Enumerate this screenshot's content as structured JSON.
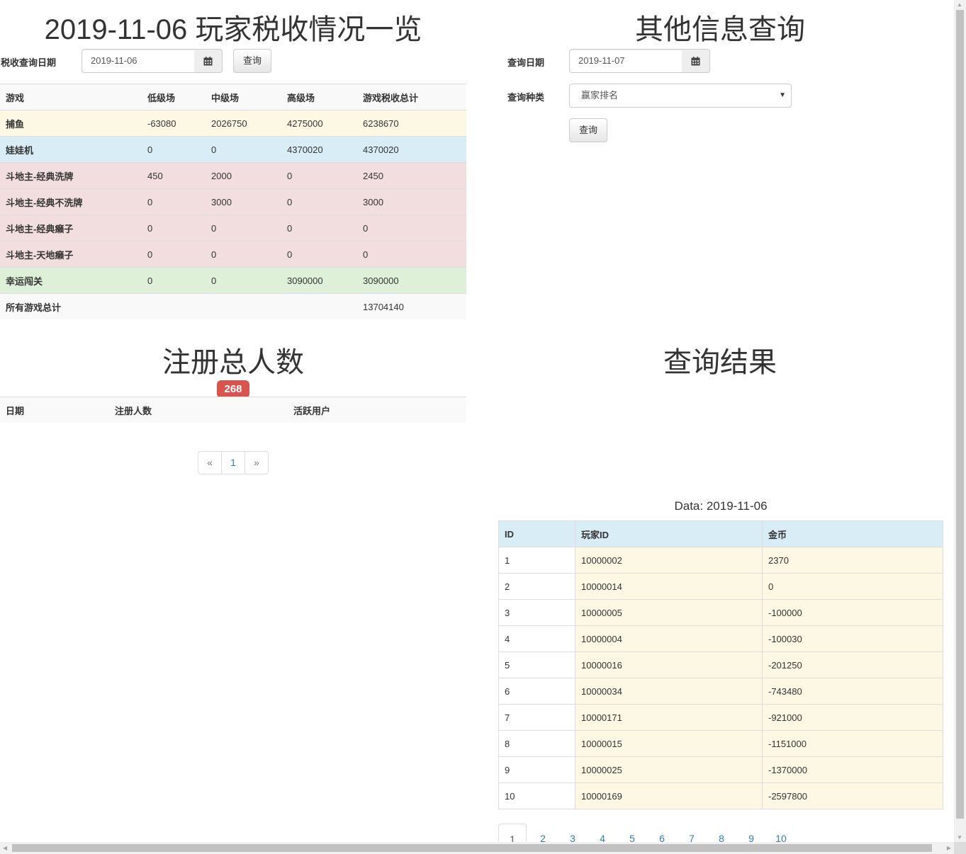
{
  "tax": {
    "title": "2019-11-06 玩家税收情况一览",
    "date_label": "税收查询日期",
    "date_value": "2019-11-06",
    "query_button": "查询",
    "headers": [
      "游戏",
      "低级场",
      "中级场",
      "高级场",
      "游戏税收总计"
    ],
    "rows": [
      {
        "game": "捕鱼",
        "low": "-63080",
        "mid": "2026750",
        "high": "4275000",
        "total": "6238670",
        "style": "warning"
      },
      {
        "game": "娃娃机",
        "low": "0",
        "mid": "0",
        "high": "4370020",
        "total": "4370020",
        "style": "info"
      },
      {
        "game": "斗地主-经典洗牌",
        "low": "450",
        "mid": "2000",
        "high": "0",
        "total": "2450",
        "style": "danger"
      },
      {
        "game": "斗地主-经典不洗牌",
        "low": "0",
        "mid": "3000",
        "high": "0",
        "total": "3000",
        "style": "danger"
      },
      {
        "game": "斗地主-经典癞子",
        "low": "0",
        "mid": "0",
        "high": "0",
        "total": "0",
        "style": "danger"
      },
      {
        "game": "斗地主-天地癞子",
        "low": "0",
        "mid": "0",
        "high": "0",
        "total": "0",
        "style": "danger"
      },
      {
        "game": "幸运闯关",
        "low": "0",
        "mid": "0",
        "high": "3090000",
        "total": "3090000",
        "style": "success"
      }
    ],
    "total_label": "所有游戏总计",
    "total_value": "13704140"
  },
  "other": {
    "title": "其他信息查询",
    "date_label": "查询日期",
    "date_value": "2019-11-07",
    "type_label": "查询种类",
    "type_value": "赢家排名",
    "query_button": "查询"
  },
  "register": {
    "title": "注册总人数",
    "count": "268",
    "headers": [
      "日期",
      "注册人数",
      "活跃用户"
    ],
    "pager": [
      "«",
      "1",
      "»"
    ]
  },
  "result": {
    "title": "查询结果",
    "data_caption": "Data: 2019-11-06",
    "headers": [
      "ID",
      "玩家ID",
      "金币"
    ],
    "rows": [
      [
        "1",
        "10000002",
        "2370"
      ],
      [
        "2",
        "10000014",
        "0"
      ],
      [
        "3",
        "10000005",
        "-100000"
      ],
      [
        "4",
        "10000004",
        "-100030"
      ],
      [
        "5",
        "10000016",
        "-201250"
      ],
      [
        "6",
        "10000034",
        "-743480"
      ],
      [
        "7",
        "10000171",
        "-921000"
      ],
      [
        "8",
        "10000015",
        "-1151000"
      ],
      [
        "9",
        "10000025",
        "-1370000"
      ],
      [
        "10",
        "10000169",
        "-2597800"
      ]
    ],
    "pages": [
      "1",
      "2",
      "3",
      "4",
      "5",
      "6",
      "7",
      "8",
      "9",
      "10"
    ],
    "active_page": "1"
  },
  "icons": {
    "calendar": "calendar-icon",
    "select_caret": "caret-down-icon"
  }
}
